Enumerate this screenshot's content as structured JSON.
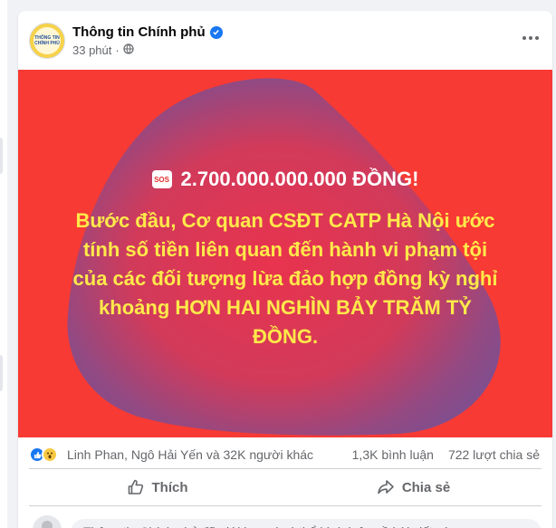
{
  "post": {
    "page_name": "Thông tin Chính phủ",
    "avatar_text": "THÔNG TIN CHÍNH PHỦ",
    "time": "33 phút",
    "audience_icon": "globe-icon",
    "verified_icon": "verified-badge-icon",
    "more_icon": "more-options-icon"
  },
  "image": {
    "background_color": "#f73a34",
    "sos_label": "SOS",
    "headline": "2.700.000.000.000 ĐỒNG!",
    "body_lines": [
      "Bước đầu, Cơ quan CSĐT CATP Hà Nội ước",
      "tính số tiền liên quan đến hành vi phạm tội",
      "của các đối tượng lừa đảo hợp đồng kỳ nghỉ",
      "khoảng HƠN HAI NGHÌN BẢY TRĂM TỶ",
      "ĐỒNG."
    ],
    "headline_color": "#ffffff",
    "body_color": "#ffe94a"
  },
  "reactions": {
    "icons": [
      "like-reaction-icon",
      "wow-reaction-icon"
    ],
    "names": "Linh Phan, Ngô Hải Yến và 32K người khác",
    "comments": "1,3K bình luận",
    "shares": "722 lượt chia sẻ"
  },
  "actions": {
    "like_label": "Thích",
    "share_label": "Chia sẻ"
  },
  "comments": {
    "restricted_notice": "Thông tin Chính phủ đã giới hạn ai có thể bình luận về bài viết này."
  },
  "colors": {
    "accent": "#1877f2",
    "text_secondary": "#65676b"
  }
}
